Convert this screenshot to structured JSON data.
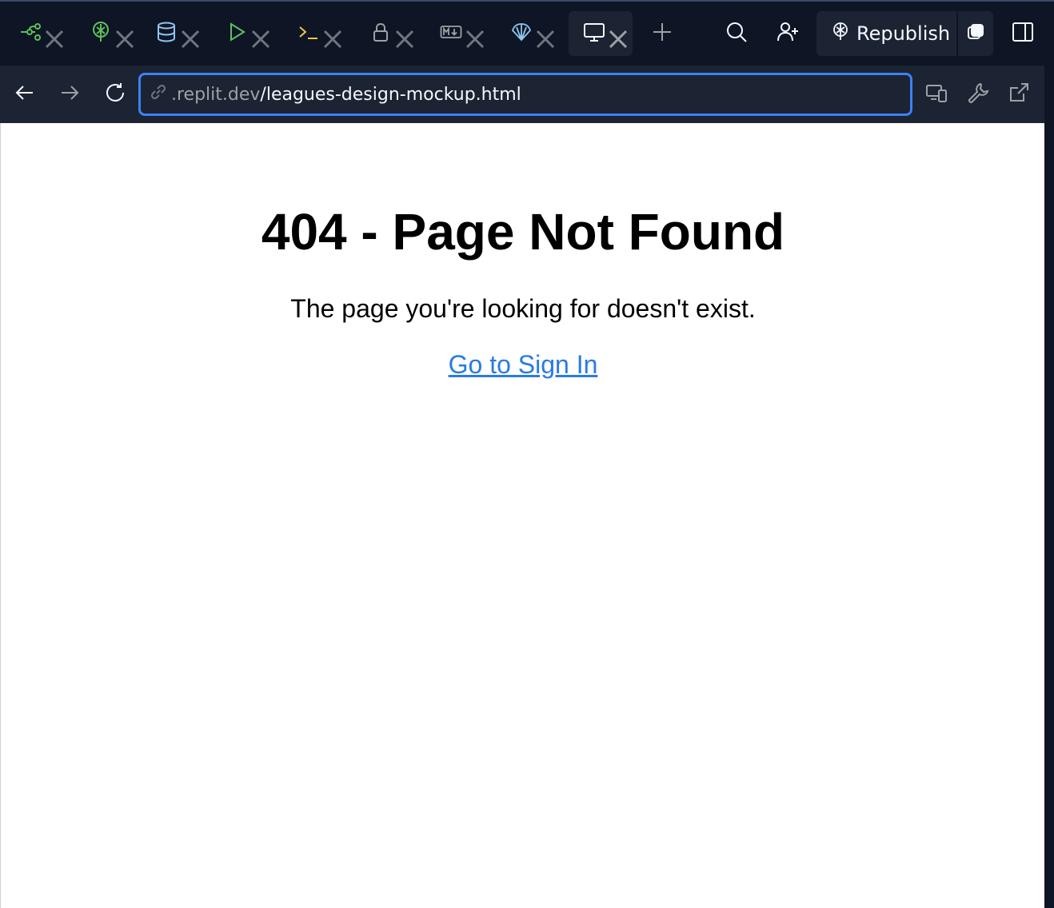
{
  "tabs": [
    {
      "icon": "git-branch-icon",
      "close": "close-icon"
    },
    {
      "icon": "deploy-tree-icon",
      "close": "close-icon"
    },
    {
      "icon": "database-icon",
      "close": "close-icon"
    },
    {
      "icon": "run-play-icon",
      "close": "close-icon"
    },
    {
      "icon": "shell-prompt-icon",
      "close": "close-icon"
    },
    {
      "icon": "lock-icon",
      "close": "close-icon"
    },
    {
      "icon": "markdown-icon",
      "close": "close-icon"
    },
    {
      "icon": "shell-agent-icon",
      "close": "close-icon"
    },
    {
      "icon": "monitor-webview-icon",
      "close": "close-icon",
      "active": true
    }
  ],
  "toolbar": {
    "republish_label": "Republish"
  },
  "browser": {
    "url_domain": ".replit.dev",
    "url_path": "/leagues-design-mockup.html"
  },
  "page": {
    "heading": "404 - Page Not Found",
    "message": "The page you're looking for doesn't exist.",
    "link_text": "Go to Sign In"
  },
  "colors": {
    "chrome_bg": "#0e1525",
    "panel_bg": "#1c2333",
    "url_focus": "#3b82f6",
    "link": "#2a7ae2"
  }
}
